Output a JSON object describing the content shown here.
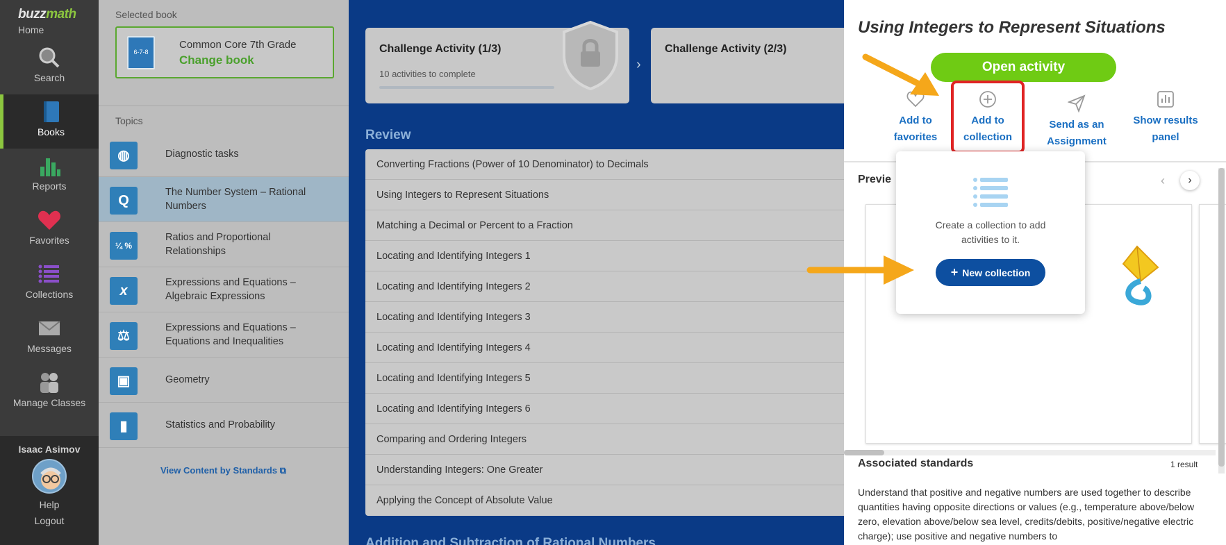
{
  "nav": {
    "logo_buzz": "buzz",
    "logo_math": "math",
    "home": "Home",
    "items": [
      {
        "label": "Search",
        "icon": "search-icon"
      },
      {
        "label": "Books",
        "icon": "book-icon",
        "active": true
      },
      {
        "label": "Reports",
        "icon": "bar-chart-icon"
      },
      {
        "label": "Favorites",
        "icon": "heart-icon"
      },
      {
        "label": "Collections",
        "icon": "list-icon"
      },
      {
        "label": "Messages",
        "icon": "envelope-icon"
      },
      {
        "label": "Manage Classes",
        "icon": "people-icon"
      }
    ],
    "user_name": "Isaac Asimov",
    "help": "Help",
    "logout": "Logout"
  },
  "book_panel": {
    "selected_label": "Selected book",
    "book_title": "Common Core 7th Grade",
    "change_book": "Change book",
    "cover_text": "6-7-8",
    "topics_label": "Topics",
    "topics": [
      {
        "label": "Diagnostic tasks",
        "icon": "globe-icon"
      },
      {
        "label": "The Number System – Rational Numbers",
        "icon": "q-icon",
        "active": true
      },
      {
        "label": "Ratios and Proportional Relationships",
        "icon": "ratio-icon"
      },
      {
        "label": "Expressions and Equations – Algebraic Expressions",
        "icon": "x-icon"
      },
      {
        "label": "Expressions and Equations – Equations and Inequalities",
        "icon": "scale-icon"
      },
      {
        "label": "Geometry",
        "icon": "cube-icon"
      },
      {
        "label": "Statistics and Probability",
        "icon": "bar-chart-icon"
      }
    ],
    "view_standards": "View Content by Standards"
  },
  "main": {
    "challenges": [
      {
        "title": "Challenge Activity (1/3)",
        "subtitle": "10 activities to complete"
      },
      {
        "title": "Challenge Activity (2/3)",
        "subtitle": ""
      }
    ],
    "review_title": "Review",
    "review_items": [
      "Converting Fractions (Power of 10 Denominator) to Decimals",
      "Using Integers to Represent Situations",
      "Matching a Decimal or Percent to a Fraction",
      "Locating and Identifying Integers 1",
      "Locating and Identifying Integers 2",
      "Locating and Identifying Integers 3",
      "Locating and Identifying Integers 4",
      "Locating and Identifying Integers 5",
      "Locating and Identifying Integers 6",
      "Comparing and Ordering Integers",
      "Understanding Integers: One Greater",
      "Applying the Concept of Absolute Value"
    ],
    "next_section_title": "Addition and Subtraction of Rational Numbers"
  },
  "drawer": {
    "title": "Using Integers to Represent Situations",
    "open_activity": "Open activity",
    "actions": [
      {
        "label_line1": "Add to",
        "label_line2": "favorites",
        "icon": "heart-outline-icon"
      },
      {
        "label_line1": "Add to",
        "label_line2": "collection",
        "icon": "plus-circle-icon"
      },
      {
        "label_line1": "Send as an",
        "label_line2": "Assignment",
        "icon": "paper-plane-icon"
      },
      {
        "label_line1": "Show results",
        "label_line2": "panel",
        "icon": "results-icon"
      }
    ],
    "preview_label": "Previe",
    "associated_standards": "Associated standards",
    "result_count": "1 result",
    "standard_text": "Understand that positive and negative numbers are used together to describe quantities having opposite directions or values (e.g., temperature above/below zero, elevation above/below sea level, credits/debits, positive/negative electric charge); use positive and negative numbers to"
  },
  "popup": {
    "text": "Create a collection to add activities to it.",
    "new_collection": "New collection"
  },
  "colors": {
    "accent_green": "#6fcb14",
    "link_blue": "#1a6fc2",
    "highlight_red": "#e02424",
    "arrow_orange": "#f5a71a",
    "button_blue": "#0d4fa0"
  }
}
